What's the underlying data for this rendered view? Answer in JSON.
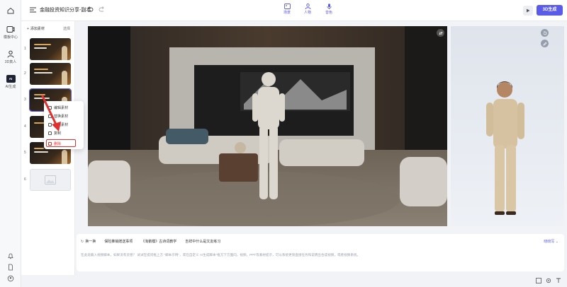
{
  "rail": {
    "items": [
      {
        "label": "模板中心",
        "icon": "template-icon"
      },
      {
        "label": "3D真人",
        "icon": "person-icon"
      },
      {
        "label": "AI生成",
        "icon": "ai-icon",
        "badge": "AI"
      }
    ]
  },
  "topbar": {
    "title": "金融投资知识分享-副本",
    "tools": [
      {
        "label": "场景",
        "icon": "scene-icon"
      },
      {
        "label": "人物",
        "icon": "character-icon"
      },
      {
        "label": "音色",
        "icon": "microphone-icon"
      }
    ],
    "generate_label": "3D生成"
  },
  "panel": {
    "add_label": "添加素材",
    "manage_label": "选择",
    "slides": [
      "1",
      "2",
      "3",
      "4",
      "5",
      "6"
    ]
  },
  "context_menu": {
    "items": [
      "编辑素材",
      "替换素材",
      "复制素材",
      "复制",
      "删除"
    ]
  },
  "script": {
    "toolbar": [
      "换一换",
      "保险推销赠送事项",
      "《淘鹅模》古诗词教学",
      "吉祥中什么是文友练习"
    ],
    "voice_label": "晓晓写",
    "placeholder": "在此处输入视频脚本，如果没有灵感？ 试试在提问框上方 \"脚本示例\"，或在自定义 AI生成脚本\"框方下方面向，视频，PPT等素材提示，可以系统更快直接任务和说明出合成视频，或者视频系统。"
  },
  "colors": {
    "accent": "#5b5bea",
    "danger": "#e03131"
  }
}
